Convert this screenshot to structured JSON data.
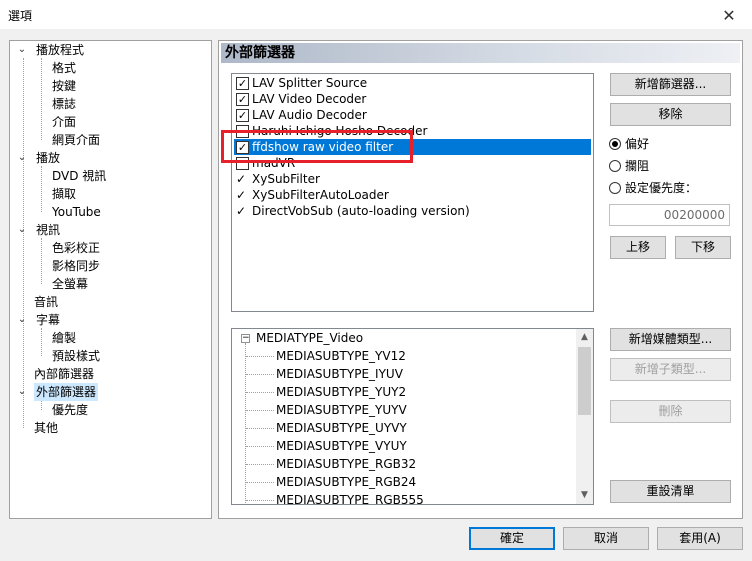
{
  "window": {
    "title": "選項",
    "close_glyph": "✕"
  },
  "tree": {
    "expand_glyph": "⌄",
    "items": [
      {
        "label": "播放程式"
      },
      {
        "label": "格式"
      },
      {
        "label": "按鍵"
      },
      {
        "label": "標誌"
      },
      {
        "label": "介面"
      },
      {
        "label": "網頁介面"
      },
      {
        "label": "播放"
      },
      {
        "label": "DVD 視訊"
      },
      {
        "label": "擷取"
      },
      {
        "label": "YouTube"
      },
      {
        "label": "視訊"
      },
      {
        "label": "色彩校正"
      },
      {
        "label": "影格同步"
      },
      {
        "label": "全螢幕"
      },
      {
        "label": "音訊"
      },
      {
        "label": "字幕"
      },
      {
        "label": "繪製"
      },
      {
        "label": "預設樣式"
      },
      {
        "label": "內部篩選器"
      },
      {
        "label": "外部篩選器"
      },
      {
        "label": "優先度"
      },
      {
        "label": "其他"
      }
    ]
  },
  "panel": {
    "heading": "外部篩選器"
  },
  "filters": [
    {
      "name": "LAV Splitter Source",
      "checked": true,
      "style": "box"
    },
    {
      "name": "LAV Video Decoder",
      "checked": true,
      "style": "box"
    },
    {
      "name": "LAV Audio Decoder",
      "checked": true,
      "style": "box"
    },
    {
      "name": "Haruhi Ichigo Hosho Decoder",
      "checked": false,
      "style": "box"
    },
    {
      "name": "ffdshow raw video filter",
      "checked": true,
      "style": "box"
    },
    {
      "name": "madVR",
      "checked": false,
      "style": "box"
    },
    {
      "name": "XySubFilter",
      "checked": true,
      "style": "tick"
    },
    {
      "name": "XySubFilterAutoLoader",
      "checked": true,
      "style": "tick"
    },
    {
      "name": "DirectVobSub (auto-loading version)",
      "checked": true,
      "style": "tick"
    }
  ],
  "filter_buttons": {
    "add": "新增篩選器...",
    "remove": "移除"
  },
  "radios": {
    "prefer": "偏好",
    "block": "攔阻",
    "set_priority": "設定優先度："
  },
  "priority_value": "00200000",
  "move_buttons": {
    "up": "上移",
    "down": "下移"
  },
  "media": {
    "root": "MEDIATYPE_Video",
    "subtypes": [
      "MEDIASUBTYPE_YV12",
      "MEDIASUBTYPE_IYUV",
      "MEDIASUBTYPE_YUY2",
      "MEDIASUBTYPE_YUYV",
      "MEDIASUBTYPE_UYVY",
      "MEDIASUBTYPE_VYUY",
      "MEDIASUBTYPE_RGB32",
      "MEDIASUBTYPE_RGB24",
      "MEDIASUBTYPE_RGB555"
    ]
  },
  "media_buttons": {
    "add_type": "新增媒體類型...",
    "add_subtype": "新增子類型...",
    "delete": "刪除",
    "reset": "重設清單"
  },
  "dialog_buttons": {
    "ok": "確定",
    "cancel": "取消",
    "apply": "套用(A)"
  }
}
